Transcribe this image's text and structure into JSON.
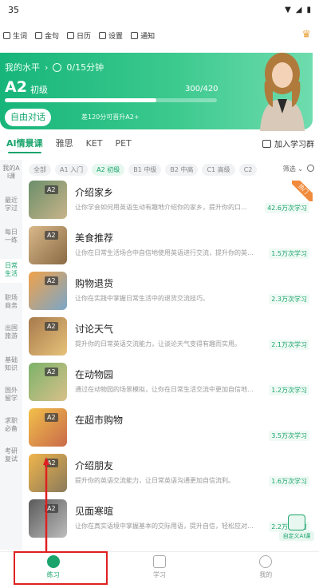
{
  "status_bar": {
    "time": "35"
  },
  "quick_links": [
    {
      "label": "生词",
      "icon": "book-icon"
    },
    {
      "label": "金句",
      "icon": "star-icon"
    },
    {
      "label": "日历",
      "icon": "calendar-icon"
    },
    {
      "label": "设置",
      "icon": "gear-icon"
    },
    {
      "label": "通知",
      "icon": "bell-icon"
    }
  ],
  "hero": {
    "my_level_label": "我的水平",
    "time_goal": "0/15分钟",
    "level": "A2",
    "level_name": "初级",
    "score": "300/420",
    "progress": 0.714,
    "free_talk_label": "自由对话",
    "hint": "差120分可晋升A2+"
  },
  "tabs": [
    {
      "label": "AI情景课",
      "active": true
    },
    {
      "label": "雅思",
      "active": false
    },
    {
      "label": "KET",
      "active": false
    },
    {
      "label": "PET",
      "active": false
    }
  ],
  "join_group_label": "加入学习群",
  "sidebar": [
    {
      "label": "我的AI课",
      "active": false
    },
    {
      "label": "最近学过",
      "active": false
    },
    {
      "label": "每日一练",
      "active": false
    },
    {
      "label": "日常生活",
      "active": true
    },
    {
      "label": "职场商务",
      "active": false
    },
    {
      "label": "出国旅游",
      "active": false
    },
    {
      "label": "基础知识",
      "active": false
    },
    {
      "label": "国外留学",
      "active": false
    },
    {
      "label": "求职必备",
      "active": false
    },
    {
      "label": "考研复试",
      "active": false
    }
  ],
  "filters": [
    {
      "label": "全部",
      "active": false
    },
    {
      "label": "A1 入门",
      "active": false
    },
    {
      "label": "A2 初级",
      "active": true
    },
    {
      "label": "B1 中级",
      "active": false
    },
    {
      "label": "B2 中高",
      "active": false
    },
    {
      "label": "C1 高级",
      "active": false
    },
    {
      "label": "C2",
      "active": false
    }
  ],
  "sort_label": "筛选",
  "courses": [
    {
      "title": "介绍家乡",
      "desc": "让你学会如何用英语生动有趣地介绍你的家乡，提升你的口…",
      "count": "42.6万次学习",
      "badge": "A2",
      "hot": true,
      "hot_label": "热门"
    },
    {
      "title": "美食推荐",
      "desc": "让你在日常生活场合中自信地使用英语进行交流，提升你的英…",
      "count": "1.5万次学习",
      "badge": "A2"
    },
    {
      "title": "购物退货",
      "desc": "让你在实践中掌握日常生活中的退货交流技巧。",
      "count": "2.3万次学习",
      "badge": "A2"
    },
    {
      "title": "讨论天气",
      "desc": "提升你的日常英语交流能力，让谈论天气变得有趣而实用。",
      "count": "2.1万次学习",
      "badge": "A2"
    },
    {
      "title": "在动物园",
      "desc": "通过在动物园的场景模拟，让你在日常生活交流中更加自信地…",
      "count": "1.2万次学习",
      "badge": "A2"
    },
    {
      "title": "在超市购物",
      "desc": "",
      "count": "3.5万次学习",
      "badge": "A2"
    },
    {
      "title": "介绍朋友",
      "desc": "提升你的英语交流能力，让日常英语沟通更加自信流利。",
      "count": "1.6万次学习",
      "badge": "A2"
    },
    {
      "title": "见面寒暄",
      "desc": "让你在真实语境中掌握基本的交际用语，提升自信，轻松应对…",
      "count": "2.2万次学习",
      "badge": "A2"
    }
  ],
  "custom_ai_label": "自定义AI课",
  "bottom_nav": [
    {
      "label": "练习",
      "active": true
    },
    {
      "label": "学习",
      "active": false
    },
    {
      "label": "我的",
      "active": false
    }
  ],
  "colors": {
    "accent": "#1aa46c",
    "highlight": "#e02020"
  }
}
